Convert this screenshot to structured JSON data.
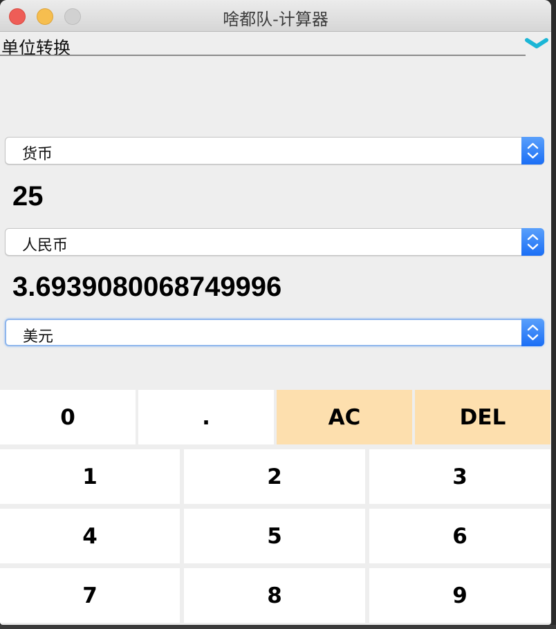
{
  "window": {
    "title": "啥都队-计算器"
  },
  "mode": {
    "label": "单位转换",
    "chevron_icon": "chevron-down-icon",
    "chevron_color": "#1bb6d6"
  },
  "converter": {
    "category": "货币",
    "input_value": "25",
    "from_unit": "人民币",
    "result_value": "3.6939080068749996",
    "to_unit": "美元"
  },
  "keypad": {
    "row1": [
      "0",
      ".",
      "AC",
      "DEL"
    ],
    "row2": [
      "1",
      "2",
      "3"
    ],
    "row3": [
      "4",
      "5",
      "6"
    ],
    "row4": [
      "7",
      "8",
      "9"
    ]
  },
  "colors": {
    "operator_key": "#fddfae",
    "select_arrow": "#1a6ef5"
  }
}
